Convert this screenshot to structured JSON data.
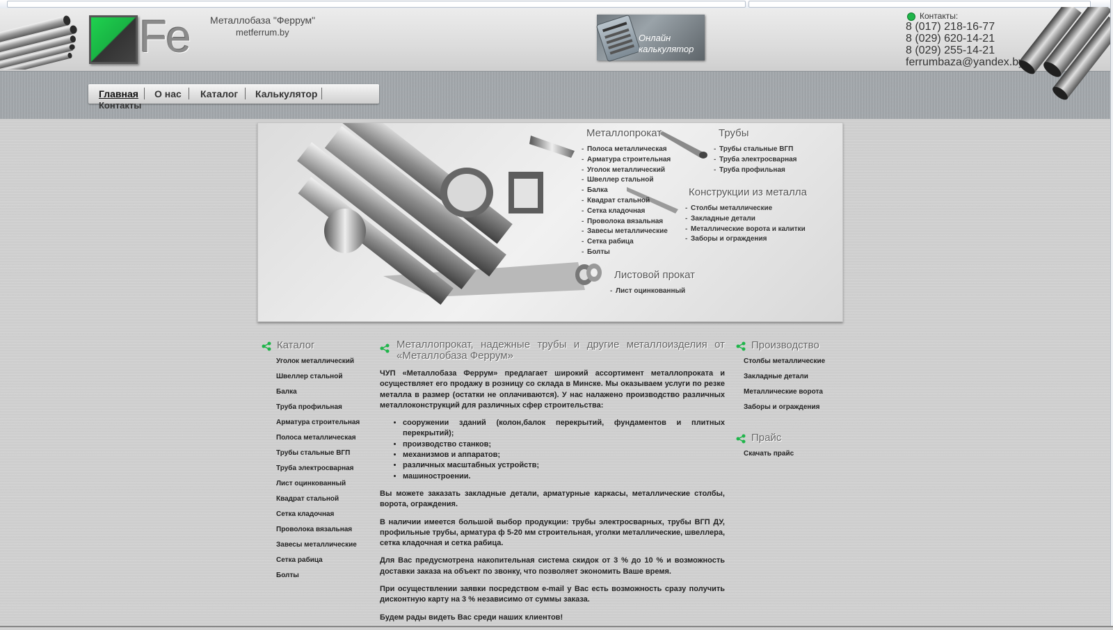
{
  "header": {
    "site_name": "Металлобаза \"Феррум\"",
    "site_url": "metferrum.by",
    "logo_text": "Fe",
    "calculator_label_1": "Онлайн",
    "calculator_label_2": "калькулятор",
    "contacts_label": "Контакты:",
    "phones": [
      "8 (017) 218-16-77",
      "8 (029) 620-14-21",
      "8 (029) 255-14-21"
    ],
    "email": "ferrumbaza@yandex.by"
  },
  "nav": {
    "items": [
      "Главная",
      "О нас",
      "Каталог",
      "Калькулятор"
    ],
    "contacts": "Контакты"
  },
  "banner": {
    "metalloprokat_title": "Металлопрокат",
    "metalloprokat_items": [
      "Полоса металлическая",
      "Арматура строительная",
      "Уголок металлический",
      "Швеллер стальной",
      "Балка",
      "Квадрат стальной",
      "Сетка кладочная",
      "Проволока вязальная",
      "Завесы металлические",
      "Сетка рабица",
      "Болты"
    ],
    "trubi_title": "Трубы",
    "trubi_items": [
      "Трубы стальные ВГП",
      "Труба электросварная",
      "Труба профильная"
    ],
    "konstr_title": "Конструкции из металла",
    "konstr_items": [
      "Столбы металлические",
      "Закладные детали",
      "Металлические ворота и калитки",
      "Заборы и ограждения"
    ],
    "list_title": "Листовой прокат",
    "list_items": [
      "Лист оцинкованный"
    ]
  },
  "catalog": {
    "title": "Каталог",
    "items": [
      "Уголок металлический",
      "Швеллер стальной",
      "Балка",
      "Труба профильная",
      "Арматура строительная",
      "Полоса металлическая",
      "Трубы стальные ВГП",
      "Труба электросварная",
      "Лист оцинкованный",
      "Квадрат стальной",
      "Сетка кладочная",
      "Проволока вязальная",
      "Завесы металлические",
      "Сетка рабица",
      "Болты"
    ]
  },
  "main": {
    "title": "Металлопрокат, надежные трубы и другие металлоизделия от «Металлобаза Феррум»",
    "p1": "ЧУП «Металлобаза Феррум» предлагает широкий ассортимент металлопроката и осуществляет его продажу в розницу со склада в Минске. Мы оказываем услуги по резке металла в размер (остатки не оплачиваются). У нас налажено производство различных металлоконструкций для различных сфер строительства:",
    "bullets": [
      "сооружении зданий (колон,балок перекрытий, фундаментов и плитных перекрытий);",
      "производство станков;",
      "механизмов и аппаратов;",
      "различных масштабных устройств;",
      "машиностроении."
    ],
    "p2": "Вы можете заказать закладные детали, арматурные каркасы, металлические столбы, ворота, ограждения.",
    "p3": "В наличии имеется большой выбор продукции: трубы электросварных, трубы ВГП ДУ, профильные трубы, арматура ф 5-20 мм строительная, уголки металлические, швеллера, сетка кладочная и сетка рабица.",
    "p4": "Для Вас предусмотрена накопительная система скидок от 3 % до 10 % и возможность доставки заказа на объект по звонку, что позволяет экономить Ваше время.",
    "p5": "При осуществлении заявки посредством e-mail у Вас есть возможность сразу получить дисконтную карту на 3 % независимо от суммы заказа.",
    "p6": "Будем рады видеть Вас среди наших клиентов!"
  },
  "production": {
    "title": "Производство",
    "items": [
      "Столбы металлические",
      "Закладные детали",
      "Металлические ворота",
      "Заборы и ограждения"
    ]
  },
  "price": {
    "title": "Прайс",
    "download": "Скачать прайс"
  },
  "colors": {
    "accent_green": "#1fb54a",
    "text_dark": "#222222",
    "heading_gray": "#666666"
  },
  "icons": {
    "section": "share-icon",
    "contact": "green-dot-icon"
  }
}
